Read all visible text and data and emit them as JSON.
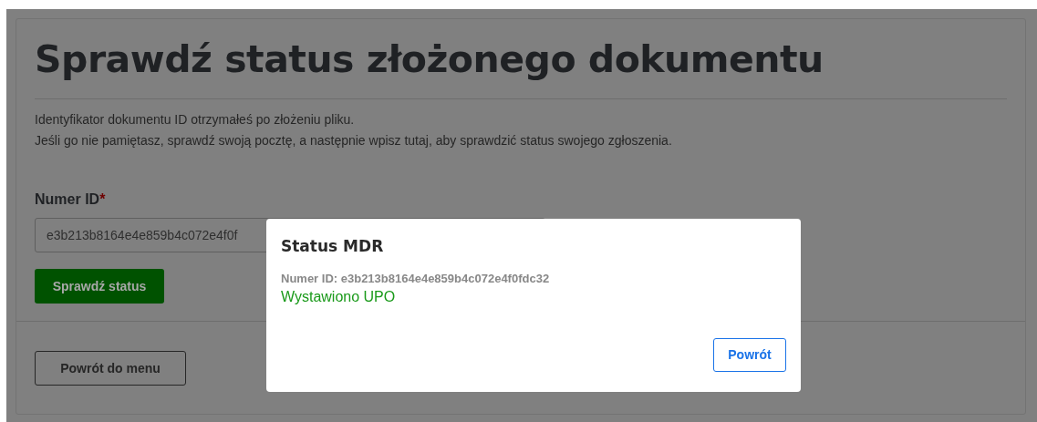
{
  "page": {
    "title": "Sprawdź status złożonego dokumentu",
    "intro": [
      "Identyfikator dokumentu ID otrzymałeś po złożeniu pliku.",
      "Jeśli go nie pamiętasz, sprawdź swoją pocztę, a następnie wpisz tutaj, aby sprawdzić status swojego zgłoszenia."
    ]
  },
  "form": {
    "label": "Numer ID",
    "required_mark": "*",
    "value": "e3b213b8164e4e859b4c072e4f0f",
    "submit": "Sprawdź status"
  },
  "back_button": "Powrót do menu",
  "modal": {
    "title": "Status MDR",
    "id_line": "Numer ID: e3b213b8164e4e859b4c072e4f0fdc32",
    "status": "Wystawiono UPO",
    "button": "Powrót"
  }
}
